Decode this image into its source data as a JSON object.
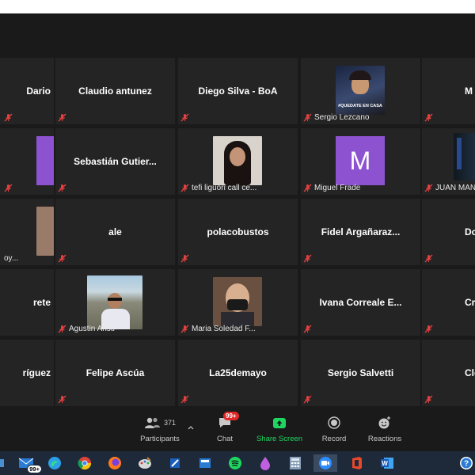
{
  "gallery": {
    "tiles": [
      {
        "row": 0,
        "col": 0,
        "name": "Dario",
        "label": "",
        "muted": true
      },
      {
        "row": 0,
        "col": 1,
        "name": "Claudio antunez",
        "label": "",
        "muted": true
      },
      {
        "row": 0,
        "col": 2,
        "name": "Diego Silva - BoA",
        "label": "",
        "muted": true
      },
      {
        "row": 0,
        "col": 3,
        "name": "",
        "label": "Sergio Lezcano",
        "muted": true,
        "photo_text": "#QUEDATE EN CASA"
      },
      {
        "row": 0,
        "col": 4,
        "name": "M",
        "label": "",
        "muted": true
      },
      {
        "row": 1,
        "col": 0,
        "name": "",
        "label": "",
        "muted": true
      },
      {
        "row": 1,
        "col": 1,
        "name": "Sebastián  Gutier...",
        "label": "",
        "muted": true
      },
      {
        "row": 1,
        "col": 2,
        "name": "",
        "label": "tefi liguori call ce...",
        "muted": true
      },
      {
        "row": 1,
        "col": 3,
        "name": "",
        "label": "Miguel Frade",
        "muted": true,
        "avatar": "M"
      },
      {
        "row": 1,
        "col": 4,
        "name": "",
        "label": "JUAN MAN",
        "muted": true
      },
      {
        "row": 2,
        "col": 0,
        "name": "",
        "label": "oy...",
        "muted": false
      },
      {
        "row": 2,
        "col": 1,
        "name": "ale",
        "label": "",
        "muted": true
      },
      {
        "row": 2,
        "col": 2,
        "name": "polacobustos",
        "label": "",
        "muted": true
      },
      {
        "row": 2,
        "col": 3,
        "name": "Fidel  Argañaraz...",
        "label": "",
        "muted": true
      },
      {
        "row": 2,
        "col": 4,
        "name": "Dolor",
        "label": "",
        "muted": true
      },
      {
        "row": 3,
        "col": 0,
        "name": "rete",
        "label": "",
        "muted": false
      },
      {
        "row": 3,
        "col": 1,
        "name": "",
        "label": "Agustin Aristi",
        "muted": true
      },
      {
        "row": 3,
        "col": 2,
        "name": "",
        "label": "Maria Soledad F...",
        "muted": true
      },
      {
        "row": 3,
        "col": 3,
        "name": "Ivana Correale E...",
        "label": "",
        "muted": true
      },
      {
        "row": 3,
        "col": 4,
        "name": "Cristi",
        "label": "",
        "muted": true
      },
      {
        "row": 4,
        "col": 0,
        "name": "ríguez",
        "label": "",
        "muted": false
      },
      {
        "row": 4,
        "col": 1,
        "name": "Felipe Ascúa",
        "label": "",
        "muted": true
      },
      {
        "row": 4,
        "col": 2,
        "name": "La25demayo",
        "label": "",
        "muted": true
      },
      {
        "row": 4,
        "col": 3,
        "name": "Sergio Salvetti",
        "label": "",
        "muted": true
      },
      {
        "row": 4,
        "col": 4,
        "name": "Cloc",
        "label": "",
        "muted": true
      }
    ]
  },
  "controls": {
    "participants_label": "Participants",
    "participants_count": "371",
    "chat_label": "Chat",
    "chat_badge": "99+",
    "share_label": "Share Screen",
    "record_label": "Record",
    "reactions_label": "Reactions",
    "share_color": "#1ed760"
  },
  "taskbar": {
    "mail_badge": "99+",
    "icons": [
      "mail-icon",
      "edge-icon",
      "chrome-icon",
      "firefox-icon",
      "paint-icon",
      "app-icon",
      "calc-icon",
      "spotify-icon",
      "drop-icon",
      "calculator-icon",
      "zoom-icon",
      "office-icon",
      "word-icon",
      "help-icon"
    ]
  }
}
